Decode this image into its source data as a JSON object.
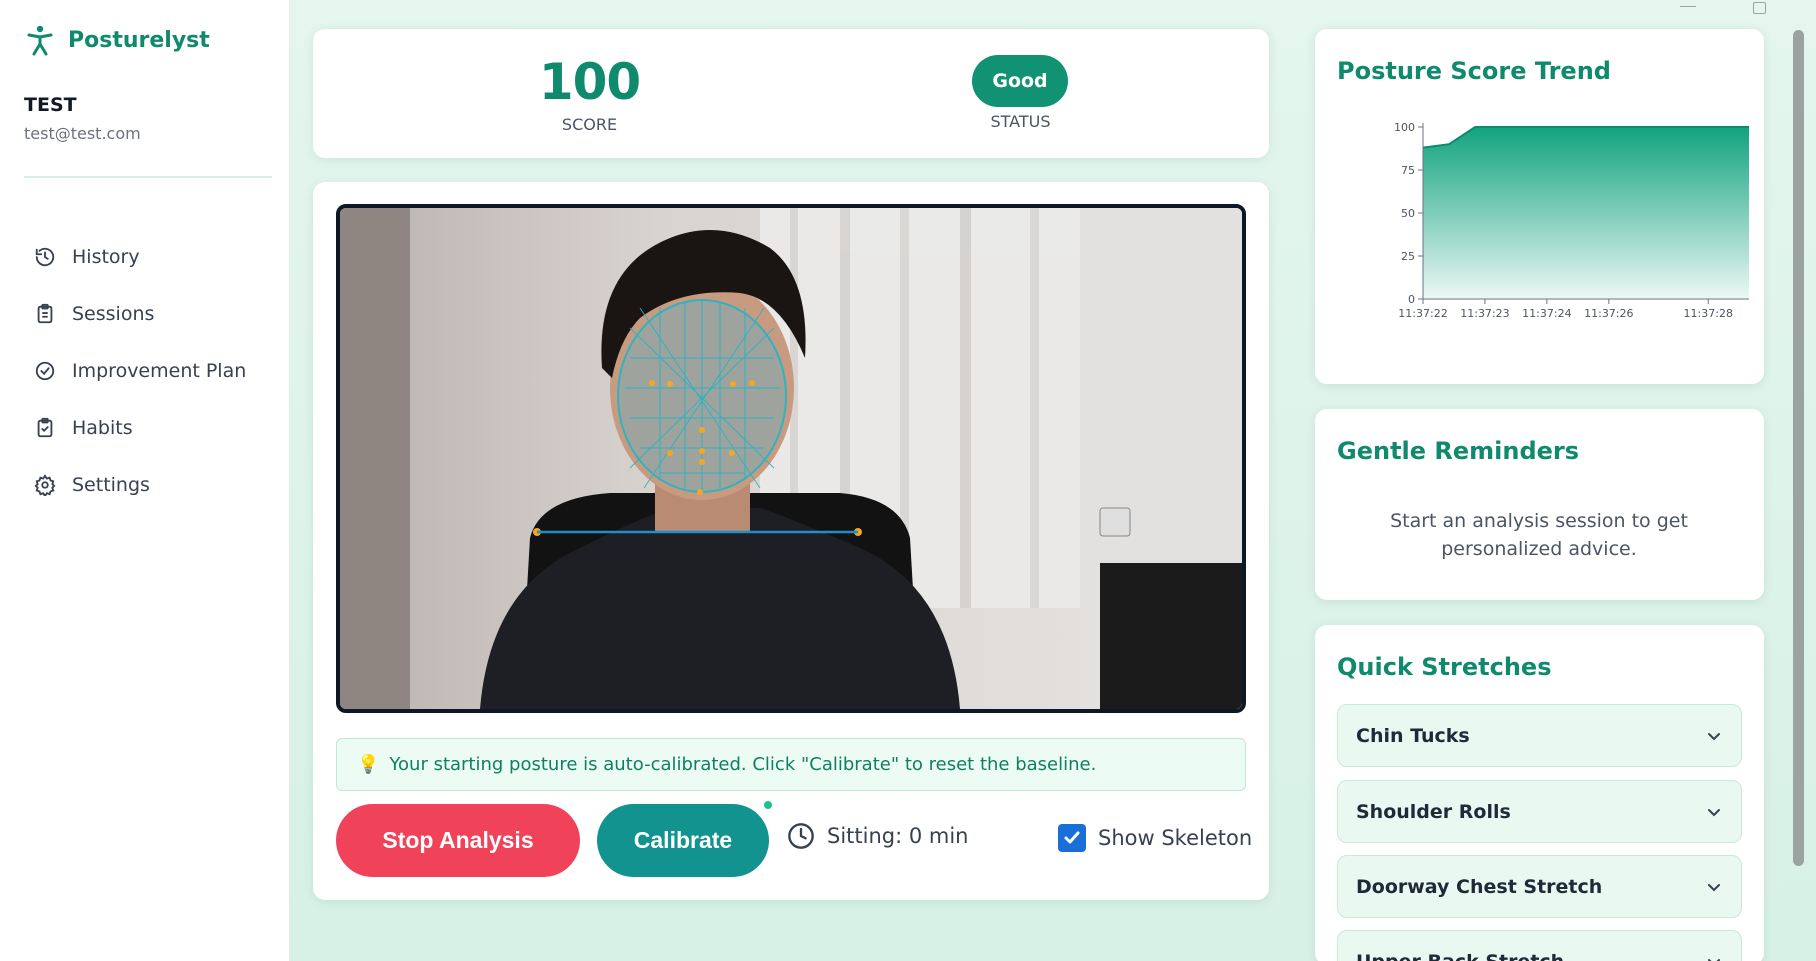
{
  "app": {
    "name": "Posturelyst",
    "accent": "#0f8a6d"
  },
  "user": {
    "name": "TEST",
    "email": "test@test.com"
  },
  "nav": [
    {
      "label": "History",
      "icon": "history-icon"
    },
    {
      "label": "Sessions",
      "icon": "clipboard-icon"
    },
    {
      "label": "Improvement Plan",
      "icon": "check-circle-icon"
    },
    {
      "label": "Habits",
      "icon": "clipboard-check-icon"
    },
    {
      "label": "Settings",
      "icon": "gear-icon"
    }
  ],
  "score": {
    "value": "100",
    "label": "SCORE",
    "status": "Good",
    "status_label": "STATUS"
  },
  "camera": {
    "tip": "Your starting posture is auto-calibrated. Click \"Calibrate\" to reset the baseline.",
    "stop_label": "Stop Analysis",
    "calibrate_label": "Calibrate",
    "sitting": "Sitting: 0 min",
    "show_skeleton_label": "Show Skeleton",
    "show_skeleton": true
  },
  "trend": {
    "title": "Posture Score Trend",
    "chart_data": {
      "type": "area",
      "x": [
        "11:37:22",
        "11:37:23",
        "11:37:24",
        "11:37:26",
        "11:37:28"
      ],
      "points": [
        {
          "t": 0.0,
          "y": 88
        },
        {
          "t": 0.08,
          "y": 90
        },
        {
          "t": 0.16,
          "y": 100
        },
        {
          "t": 1.0,
          "y": 100
        }
      ],
      "yticks": [
        0,
        25,
        50,
        75,
        100
      ],
      "ylim": [
        0,
        100
      ],
      "color": "#12a37f"
    }
  },
  "reminders": {
    "title": "Gentle Reminders",
    "text": "Start an analysis session to get personalized advice."
  },
  "stretches": {
    "title": "Quick Stretches",
    "items": [
      "Chin Tucks",
      "Shoulder Rolls",
      "Doorway Chest Stretch",
      "Upper Back Stretch"
    ]
  }
}
